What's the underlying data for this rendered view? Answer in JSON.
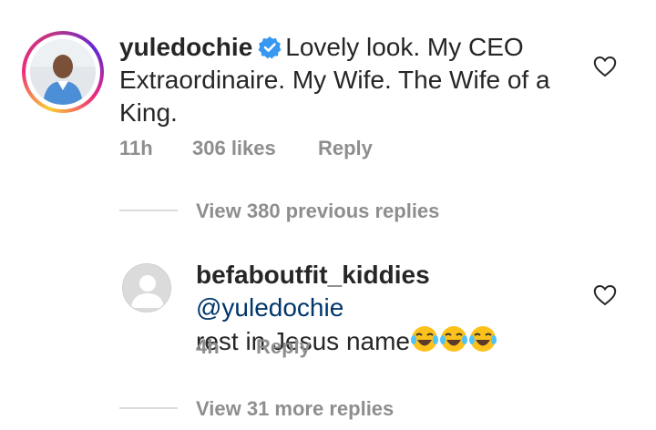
{
  "comment": {
    "username": "yuledochie",
    "text": "Lovely look. My CEO Extraordinaire. My Wife. The Wife of a King.",
    "time": "11h",
    "likes": "306 likes",
    "reply_label": "Reply",
    "verified": true
  },
  "view_previous": "View 380 previous replies",
  "reply": {
    "username": "befaboutfit_kiddies",
    "mention": "@yuledochie",
    "text": "rest in Jesus name",
    "emojis": [
      "face-with-tears-of-joy",
      "face-with-tears-of-joy",
      "face-with-tears-of-joy"
    ],
    "time": "4h",
    "reply_label": "Reply"
  },
  "view_more": "View 31 more replies",
  "colors": {
    "text": "#262626",
    "muted": "#8e8e8e",
    "mention": "#00376b",
    "verified": "#3897f0"
  }
}
